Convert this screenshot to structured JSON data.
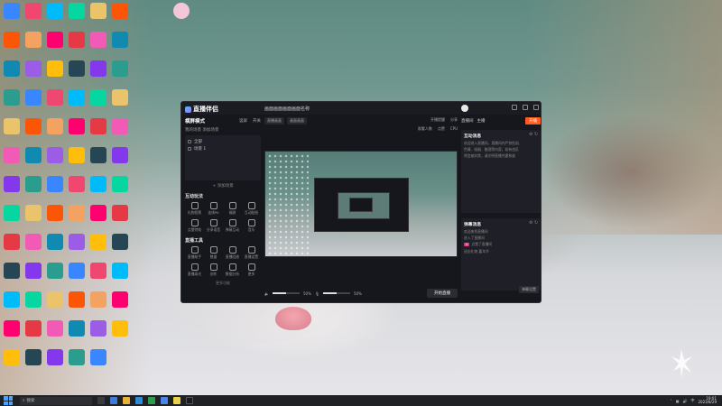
{
  "app": {
    "name": "直播伴侣",
    "doc_title": "画面画面画面画面名称",
    "left": {
      "title": "横屏模式",
      "links": [
        "竖屏",
        "开关"
      ],
      "subtitle": "我的场景  添加场景",
      "scenes": [
        "全部",
        "场景 1"
      ],
      "add_scene": "+ 添加场景",
      "interact_title": "互动玩法",
      "interact_tools": [
        "礼物投票",
        "连线PK",
        "福袋",
        "互动贴纸",
        "点赞特效",
        "分享语音",
        "弹幕互动",
        "音乐"
      ],
      "tools_title": "直播工具",
      "live_tools": [
        "直播助手",
        "数据",
        "直播回放",
        "直播设置",
        "直播高光",
        "创作",
        "数据分析",
        "更多"
      ],
      "more": "更多功能"
    },
    "center": {
      "chips": [
        "直播画面",
        "画面画面"
      ],
      "stats_top": [
        "开播提醒",
        "分享"
      ],
      "stats": [
        "观看人数",
        "点赞",
        "CPU"
      ],
      "volume_label": "50%",
      "mic_label": "50%",
      "start_button": "开始直播"
    },
    "right": {
      "tabs": [
        "直播间",
        "主播"
      ],
      "live_button": "开播",
      "box1_title": "互动消息",
      "box1_lines": [
        "欢迎进入直播间，直播间内严禁低俗、",
        "色情、吸烟、酗酒等内容，若有违反",
        "将会被封禁，请文明直播共建和谐"
      ],
      "box2_title": "弹幕消息",
      "box2_lines": [
        "欢迎来到直播间",
        "进入了直播间",
        "点赞了直播间",
        "送出礼物 嘉年华"
      ],
      "settings": "弹幕设置"
    }
  },
  "taskbar": {
    "search_placeholder": "搜索",
    "time": "19:01",
    "date": "2023/8/29",
    "lang": "中"
  },
  "desktop": {
    "icon_labels": [
      "回收站",
      "Adobe",
      "TIM",
      "迅雷",
      "百度网盘",
      "Steam",
      "Epic Games Launcher",
      "Chrome",
      "Microsoft Edge",
      "微信",
      "QQ",
      "网易云音乐",
      "OBS",
      "WPS",
      "Unity",
      "Python"
    ]
  }
}
